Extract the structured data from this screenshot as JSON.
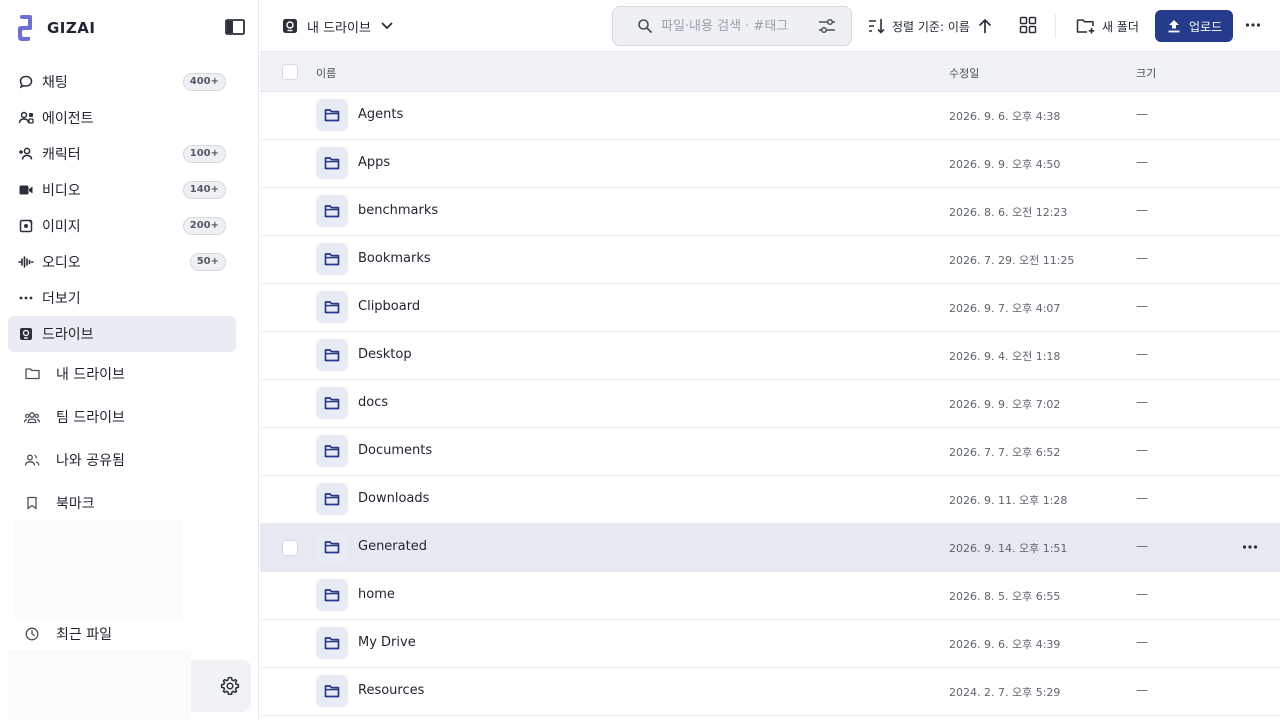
{
  "brand": {
    "name": "GIZAI",
    "accent": "#5b5fc7"
  },
  "sidebar": {
    "items": [
      {
        "label": "채팅",
        "badge": "400+",
        "icon": "chat-icon"
      },
      {
        "label": "에이전트",
        "badge": "",
        "icon": "agent-icon"
      },
      {
        "label": "캐릭터",
        "badge": "100+",
        "icon": "character-icon"
      },
      {
        "label": "비디오",
        "badge": "140+",
        "icon": "video-icon"
      },
      {
        "label": "이미지",
        "badge": "200+",
        "icon": "image-icon"
      },
      {
        "label": "오디오",
        "badge": "50+",
        "icon": "audio-icon"
      },
      {
        "label": "더보기",
        "badge": "",
        "icon": "more-icon"
      },
      {
        "label": "드라이브",
        "badge": "",
        "icon": "drive-icon"
      }
    ],
    "drive_sub": [
      {
        "label": "내 드라이브",
        "icon": "folder-icon"
      },
      {
        "label": "팀 드라이브",
        "icon": "team-icon"
      },
      {
        "label": "나와 공유됨",
        "icon": "shared-icon"
      },
      {
        "label": "북마크",
        "icon": "bookmark-icon"
      }
    ],
    "recent": {
      "label": "최근 파일",
      "icon": "clock-icon"
    }
  },
  "toolbar": {
    "drive_label": "내 드라이브",
    "search_placeholder": "파일·내용 검색 · #태그",
    "sort_label": "정렬 기준: 이름",
    "new_folder_label": "새 폴더",
    "upload_label": "업로드"
  },
  "table": {
    "headers": {
      "name": "이름",
      "modified": "수정일",
      "size": "크기"
    },
    "rows": [
      {
        "name": "Agents",
        "modified": "2026. 9. 6. 오후 4:38",
        "size": "—"
      },
      {
        "name": "Apps",
        "modified": "2026. 9. 9. 오후 4:50",
        "size": "—"
      },
      {
        "name": "benchmarks",
        "modified": "2026. 8. 6. 오전 12:23",
        "size": "—"
      },
      {
        "name": "Bookmarks",
        "modified": "2026. 7. 29. 오전 11:25",
        "size": "—"
      },
      {
        "name": "Clipboard",
        "modified": "2026. 9. 7. 오후 4:07",
        "size": "—"
      },
      {
        "name": "Desktop",
        "modified": "2026. 9. 4. 오전 1:18",
        "size": "—"
      },
      {
        "name": "docs",
        "modified": "2026. 9. 9. 오후 7:02",
        "size": "—"
      },
      {
        "name": "Documents",
        "modified": "2026. 7. 7. 오후 6:52",
        "size": "—"
      },
      {
        "name": "Downloads",
        "modified": "2026. 9. 11. 오후 1:28",
        "size": "—"
      },
      {
        "name": "Generated",
        "modified": "2026. 9. 14. 오후 1:51",
        "size": "—",
        "selected": true
      },
      {
        "name": "home",
        "modified": "2026. 8. 5. 오후 6:55",
        "size": "—"
      },
      {
        "name": "My Drive",
        "modified": "2026. 9. 6. 오후 4:39",
        "size": "—"
      },
      {
        "name": "Resources",
        "modified": "2024. 2. 7. 오후 5:29",
        "size": "—"
      }
    ]
  }
}
